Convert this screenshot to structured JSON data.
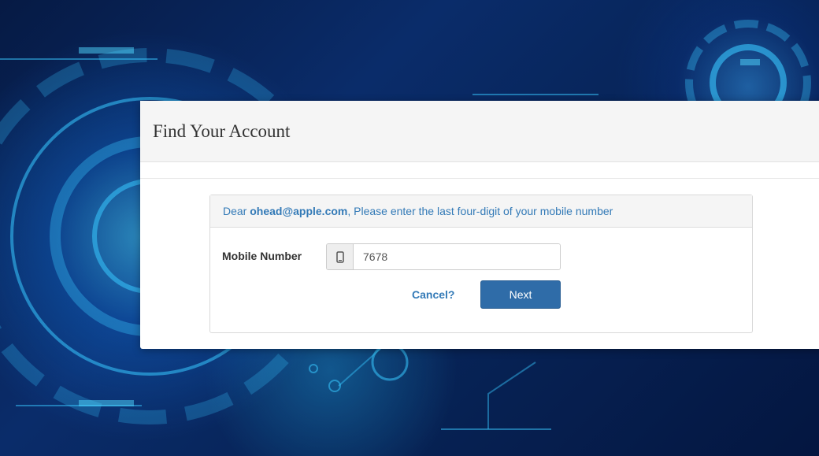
{
  "page": {
    "title": "Find Your Account"
  },
  "prompt": {
    "prefix": "Dear ",
    "email": "ohead@apple.com",
    "suffix": ", Please enter the last four-digit of your mobile number"
  },
  "form": {
    "mobile_label": "Mobile Number",
    "mobile_value": "7678",
    "phone_icon": "mobile-phone-icon"
  },
  "actions": {
    "cancel_label": "Cancel?",
    "next_label": "Next"
  },
  "colors": {
    "link": "#337ab7",
    "primary_button": "#2f6ca8",
    "background": "#0a2c6a"
  }
}
